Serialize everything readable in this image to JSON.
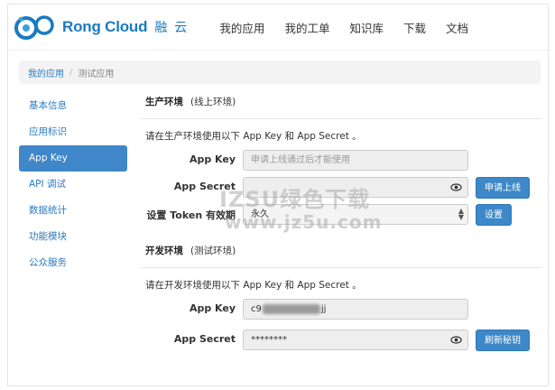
{
  "header": {
    "logo_text": "Rong Cloud",
    "logo_cn": "融云",
    "nav": [
      "我的应用",
      "我的工单",
      "知识库",
      "下载",
      "文档"
    ]
  },
  "breadcrumb": {
    "link": "我的应用",
    "separator": "/",
    "current": "测试应用"
  },
  "sidebar": {
    "items": [
      "基本信息",
      "应用标识",
      "App Key",
      "API 调试",
      "数据统计",
      "功能模块",
      "公众服务"
    ],
    "active_index": 2
  },
  "production": {
    "title": "生产环境",
    "title_note": "(线上环境)",
    "description": "请在生产环境使用以下 App Key 和 App Secret 。",
    "app_key_label": "App Key",
    "app_key_placeholder": "申请上线通过后才能使用",
    "app_secret_label": "App Secret",
    "apply_button": "申请上线",
    "token_label": "设置 Token 有效期",
    "token_value": "永久",
    "set_button": "设置"
  },
  "development": {
    "title": "开发环境",
    "title_note": "(测试环境)",
    "description": "请在开发环境使用以下 App Key 和 App Secret 。",
    "app_key_label": "App Key",
    "app_key_prefix": "c9",
    "app_key_suffix": "jj",
    "app_secret_label": "App Secret",
    "app_secret_masked": "********",
    "refresh_button": "刷新秘钥"
  },
  "watermark": {
    "line1": "IZSU绿色下载",
    "line2": "www.jz5u.com"
  },
  "colors": {
    "brand": "#1b7ac2",
    "accent": "#3f87c8",
    "link": "#2b79c1"
  }
}
